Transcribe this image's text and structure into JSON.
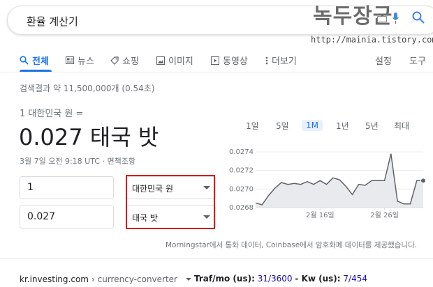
{
  "search": {
    "query": "환율 계산기"
  },
  "watermark": {
    "logo_text": "녹두장군",
    "url": "http://mainia.tistory.com"
  },
  "tabs": [
    {
      "label": "전체",
      "icon": "search-icon"
    },
    {
      "label": "뉴스",
      "icon": "news-icon"
    },
    {
      "label": "쇼핑",
      "icon": "tag-icon"
    },
    {
      "label": "이미지",
      "icon": "image-icon"
    },
    {
      "label": "동영상",
      "icon": "video-icon"
    },
    {
      "label": "더보기",
      "icon": "more-icon"
    }
  ],
  "tools": {
    "settings": "설정",
    "tools": "도구"
  },
  "result_stats": "검색결과 약 11,500,000개 (0.54초)",
  "converter": {
    "from_line": "1 대한민국 원 =",
    "result": "0.027 태국 밧",
    "timestamp": "3월 7일 오전 9:18 UTC · 면책조항",
    "from_amount": "1",
    "from_currency": "대한민국 원",
    "to_amount": "0.027",
    "to_currency": "태국 밧"
  },
  "ranges": [
    "1일",
    "5일",
    "1M",
    "1년",
    "5년",
    "최대"
  ],
  "active_range": "1M",
  "chart_data": {
    "type": "area",
    "y_ticks": [
      "0.0274",
      "0.0272",
      "0.0270",
      "0.0268"
    ],
    "ylim": [
      0.0268,
      0.0274
    ],
    "x_ticks": [
      "2월 16일",
      "2월 26일"
    ],
    "values": [
      0.02685,
      0.02683,
      0.02693,
      0.02701,
      0.02707,
      0.02705,
      0.02706,
      0.02705,
      0.02708,
      0.02705,
      0.02709,
      0.02705,
      0.02712,
      0.0271,
      0.02703,
      0.02694,
      0.02705,
      0.02704,
      0.02709,
      0.02709,
      0.02709,
      0.02738,
      0.02687,
      0.02684,
      0.02684,
      0.02709,
      0.02709
    ]
  },
  "source_note": "Morningstar에서 통화 데이터, Coinbase에서 암호화폐 데이터를 제공했습니다.",
  "footer": {
    "site": "kr.investing.com",
    "path": "› currency-converter",
    "traffic_label": "Traf/mo (us):",
    "traffic_value": "31/3600",
    "kw_label": "- Kw (us):",
    "kw_value": "7/454"
  }
}
